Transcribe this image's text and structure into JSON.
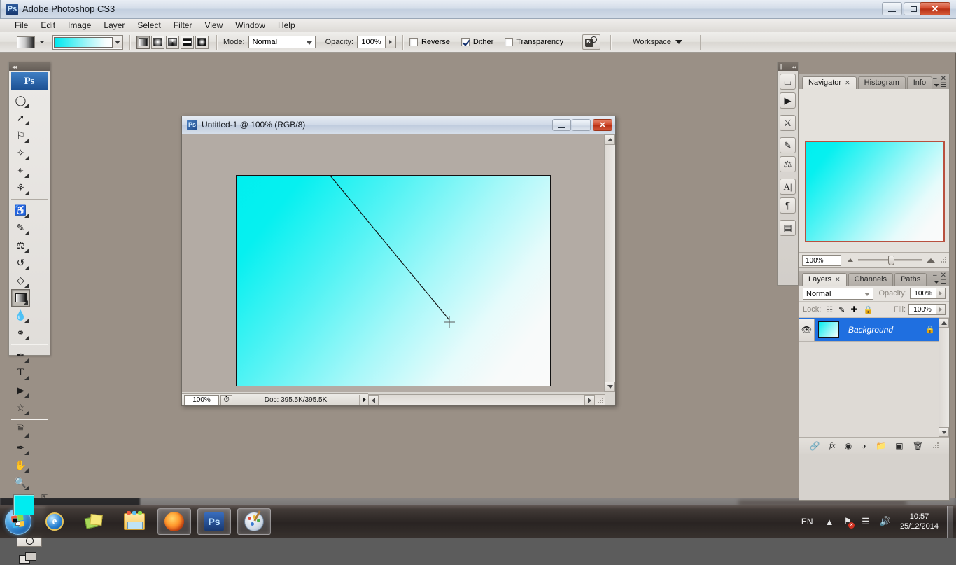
{
  "app": {
    "title": "Adobe Photoshop CS3",
    "icon": "Ps",
    "window_buttons": {
      "minimize": "minimize-icon",
      "maximize": "maximize-icon",
      "close": "✕"
    }
  },
  "menubar": {
    "items": [
      "File",
      "Edit",
      "Image",
      "Layer",
      "Select",
      "Filter",
      "View",
      "Window",
      "Help"
    ]
  },
  "options_bar": {
    "gradient_preset_label": "gradient-preset-thumbnail",
    "gradient_types": [
      "Linear Gradient",
      "Radial Gradient",
      "Angle Gradient",
      "Reflected Gradient",
      "Diamond Gradient"
    ],
    "active_gradient_type": "Linear Gradient",
    "mode_label": "Mode:",
    "mode_value": "Normal",
    "opacity_label": "Opacity:",
    "opacity_value": "100%",
    "reverse_label": "Reverse",
    "reverse_checked": false,
    "dither_label": "Dither",
    "dither_checked": true,
    "transparency_label": "Transparency",
    "transparency_checked": false,
    "bridge_label": "Br",
    "workspace_label": "Workspace"
  },
  "toolbox": {
    "logo": "Ps",
    "tools": [
      "marquee-tool",
      "move-tool",
      "lasso-tool",
      "magic-wand-tool",
      "crop-tool",
      "slice-tool",
      "healing-brush-tool",
      "brush-tool",
      "clone-stamp-tool",
      "history-brush-tool",
      "eraser-tool",
      "gradient-tool",
      "blur-tool",
      "dodge-tool",
      "pen-tool",
      "type-tool",
      "path-selection-tool",
      "shape-tool",
      "notes-tool",
      "eyedropper-tool",
      "hand-tool",
      "zoom-tool"
    ],
    "active_tool": "gradient-tool",
    "foreground_color": "#00ecf0",
    "background_color": "#ffffff",
    "quick_mask_label": "quick-mask-mode",
    "screen_mode_label": "screen-mode"
  },
  "document": {
    "icon": "Ps",
    "title": "Untitled-1 @ 100% (RGB/8)",
    "zoom": "100%",
    "doc_size": "Doc: 395.5K/395.5K",
    "canvas": {
      "gradient_from": "#00efef",
      "gradient_to": "#fafafa",
      "gradient_angle_deg": 128
    }
  },
  "icon_dock": {
    "buttons": [
      "actions-icon",
      "play-icon",
      "tool-presets-icon",
      "brushes-icon",
      "clone-source-icon",
      "character-icon",
      "paragraph-icon",
      "layer-comps-icon"
    ]
  },
  "navigator_panel": {
    "tabs": [
      "Navigator",
      "Histogram",
      "Info"
    ],
    "active_tab": "Navigator",
    "zoom_value": "100%",
    "view_box_color": "#b8503f"
  },
  "layers_panel": {
    "tabs": [
      "Layers",
      "Channels",
      "Paths"
    ],
    "active_tab": "Layers",
    "blend_mode": "Normal",
    "opacity_label": "Opacity:",
    "opacity_value": "100%",
    "lock_label": "Lock:",
    "lock_icons": [
      "lock-transparent-pixels-icon",
      "lock-image-pixels-icon",
      "lock-position-icon",
      "lock-all-icon"
    ],
    "fill_label": "Fill:",
    "fill_value": "100%",
    "layers": [
      {
        "name": "Background",
        "visible": true,
        "locked": true,
        "selected": true
      }
    ],
    "footer_buttons": [
      "link-layers-icon",
      "layer-style-icon",
      "layer-mask-icon",
      "adjustment-layer-icon",
      "new-group-icon",
      "new-layer-icon",
      "delete-layer-icon"
    ],
    "footer_fx_label": "fx"
  },
  "taskbar": {
    "start_label": "start-orb",
    "items": [
      {
        "name": "internet-explorer",
        "open": false
      },
      {
        "name": "sticky-notes",
        "open": false
      },
      {
        "name": "windows-explorer",
        "open": false
      },
      {
        "name": "mozilla-firefox",
        "open": true
      },
      {
        "name": "adobe-photoshop",
        "open": true
      },
      {
        "name": "paint",
        "open": true
      }
    ],
    "language": "EN",
    "tray_icons": [
      "show-hidden-icons-chevron",
      "network-icon",
      "signal-icon",
      "volume-icon"
    ],
    "time": "10:57",
    "date": "25/12/2014"
  }
}
